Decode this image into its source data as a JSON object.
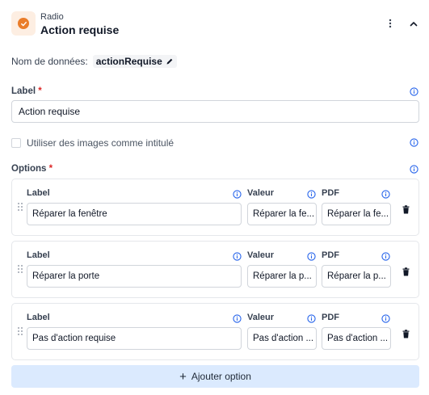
{
  "header": {
    "type_label": "Radio",
    "title": "Action requise",
    "accent": "#ea7d2a",
    "icon": "radio-check-icon"
  },
  "data_name": {
    "label": "Nom de données:",
    "value": "actionRequise"
  },
  "label_field": {
    "label": "Label",
    "required_mark": "*",
    "value": "Action requise"
  },
  "use_images": {
    "label": "Utiliser des images comme intitulé",
    "checked": false
  },
  "options": {
    "label": "Options",
    "required_mark": "*",
    "columns": {
      "label": "Label",
      "value": "Valeur",
      "pdf": "PDF"
    },
    "items": [
      {
        "label": "Réparer la fenêtre",
        "value": "Réparer la fe...",
        "pdf": "Réparer la fe..."
      },
      {
        "label": "Réparer la porte",
        "value": "Réparer la p...",
        "pdf": "Réparer la p..."
      },
      {
        "label": "Pas d'action requise",
        "value": "Pas d'action ...",
        "pdf": "Pas d'action ..."
      }
    ]
  },
  "add_button": {
    "label": "Ajouter option",
    "background": "#dbeafe"
  },
  "colors": {
    "info": "#2563eb",
    "required": "#dc2626"
  }
}
